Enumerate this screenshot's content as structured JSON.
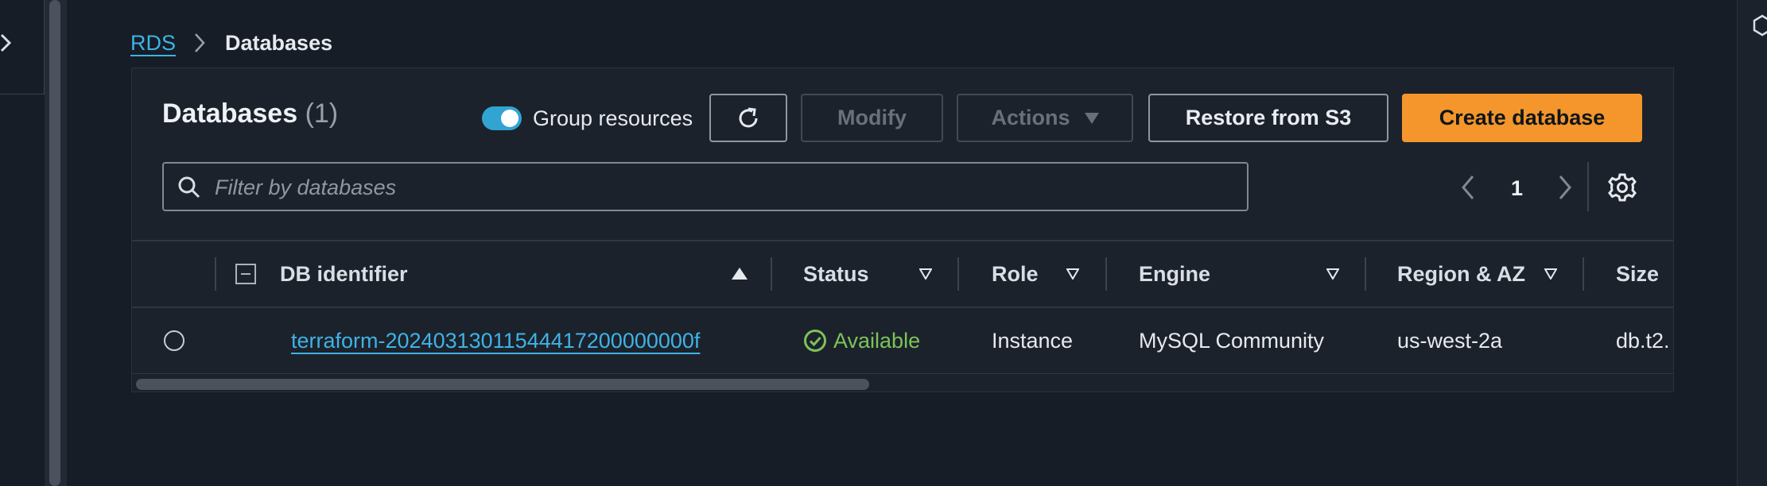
{
  "breadcrumb": {
    "root": "RDS",
    "current": "Databases"
  },
  "header": {
    "title": "Databases",
    "count": "(1)",
    "group_resources_label": "Group resources",
    "group_resources_on": true
  },
  "toolbar": {
    "modify_label": "Modify",
    "actions_label": "Actions",
    "restore_label": "Restore from S3",
    "create_label": "Create database"
  },
  "search": {
    "placeholder": "Filter by databases",
    "value": ""
  },
  "pagination": {
    "current_page": "1"
  },
  "table": {
    "columns": [
      "DB identifier",
      "Status",
      "Role",
      "Engine",
      "Region & AZ",
      "Size"
    ],
    "sort": {
      "column": "DB identifier",
      "direction": "ascending"
    },
    "rows": [
      {
        "db_identifier": "terraform-20240313011544417200000000f",
        "status": "Available",
        "role": "Instance",
        "engine": "MySQL Community",
        "region": "us-west-2a",
        "size": "db.t2."
      }
    ]
  },
  "colors": {
    "background": "#161d26",
    "panel": "#1c222b",
    "link": "#3fb2e6",
    "primary_button": "#f4962b",
    "status_available": "#7cc35a",
    "toggle_on": "#31a4d2"
  },
  "icons": [
    "close-icon",
    "chevron-right-icon",
    "refresh-icon",
    "caret-down-icon",
    "search-icon",
    "chevron-left-icon",
    "settings-gear-icon",
    "sort-ascending-icon",
    "sort-descending-icon",
    "check-circle-icon",
    "collapse-icon"
  ]
}
